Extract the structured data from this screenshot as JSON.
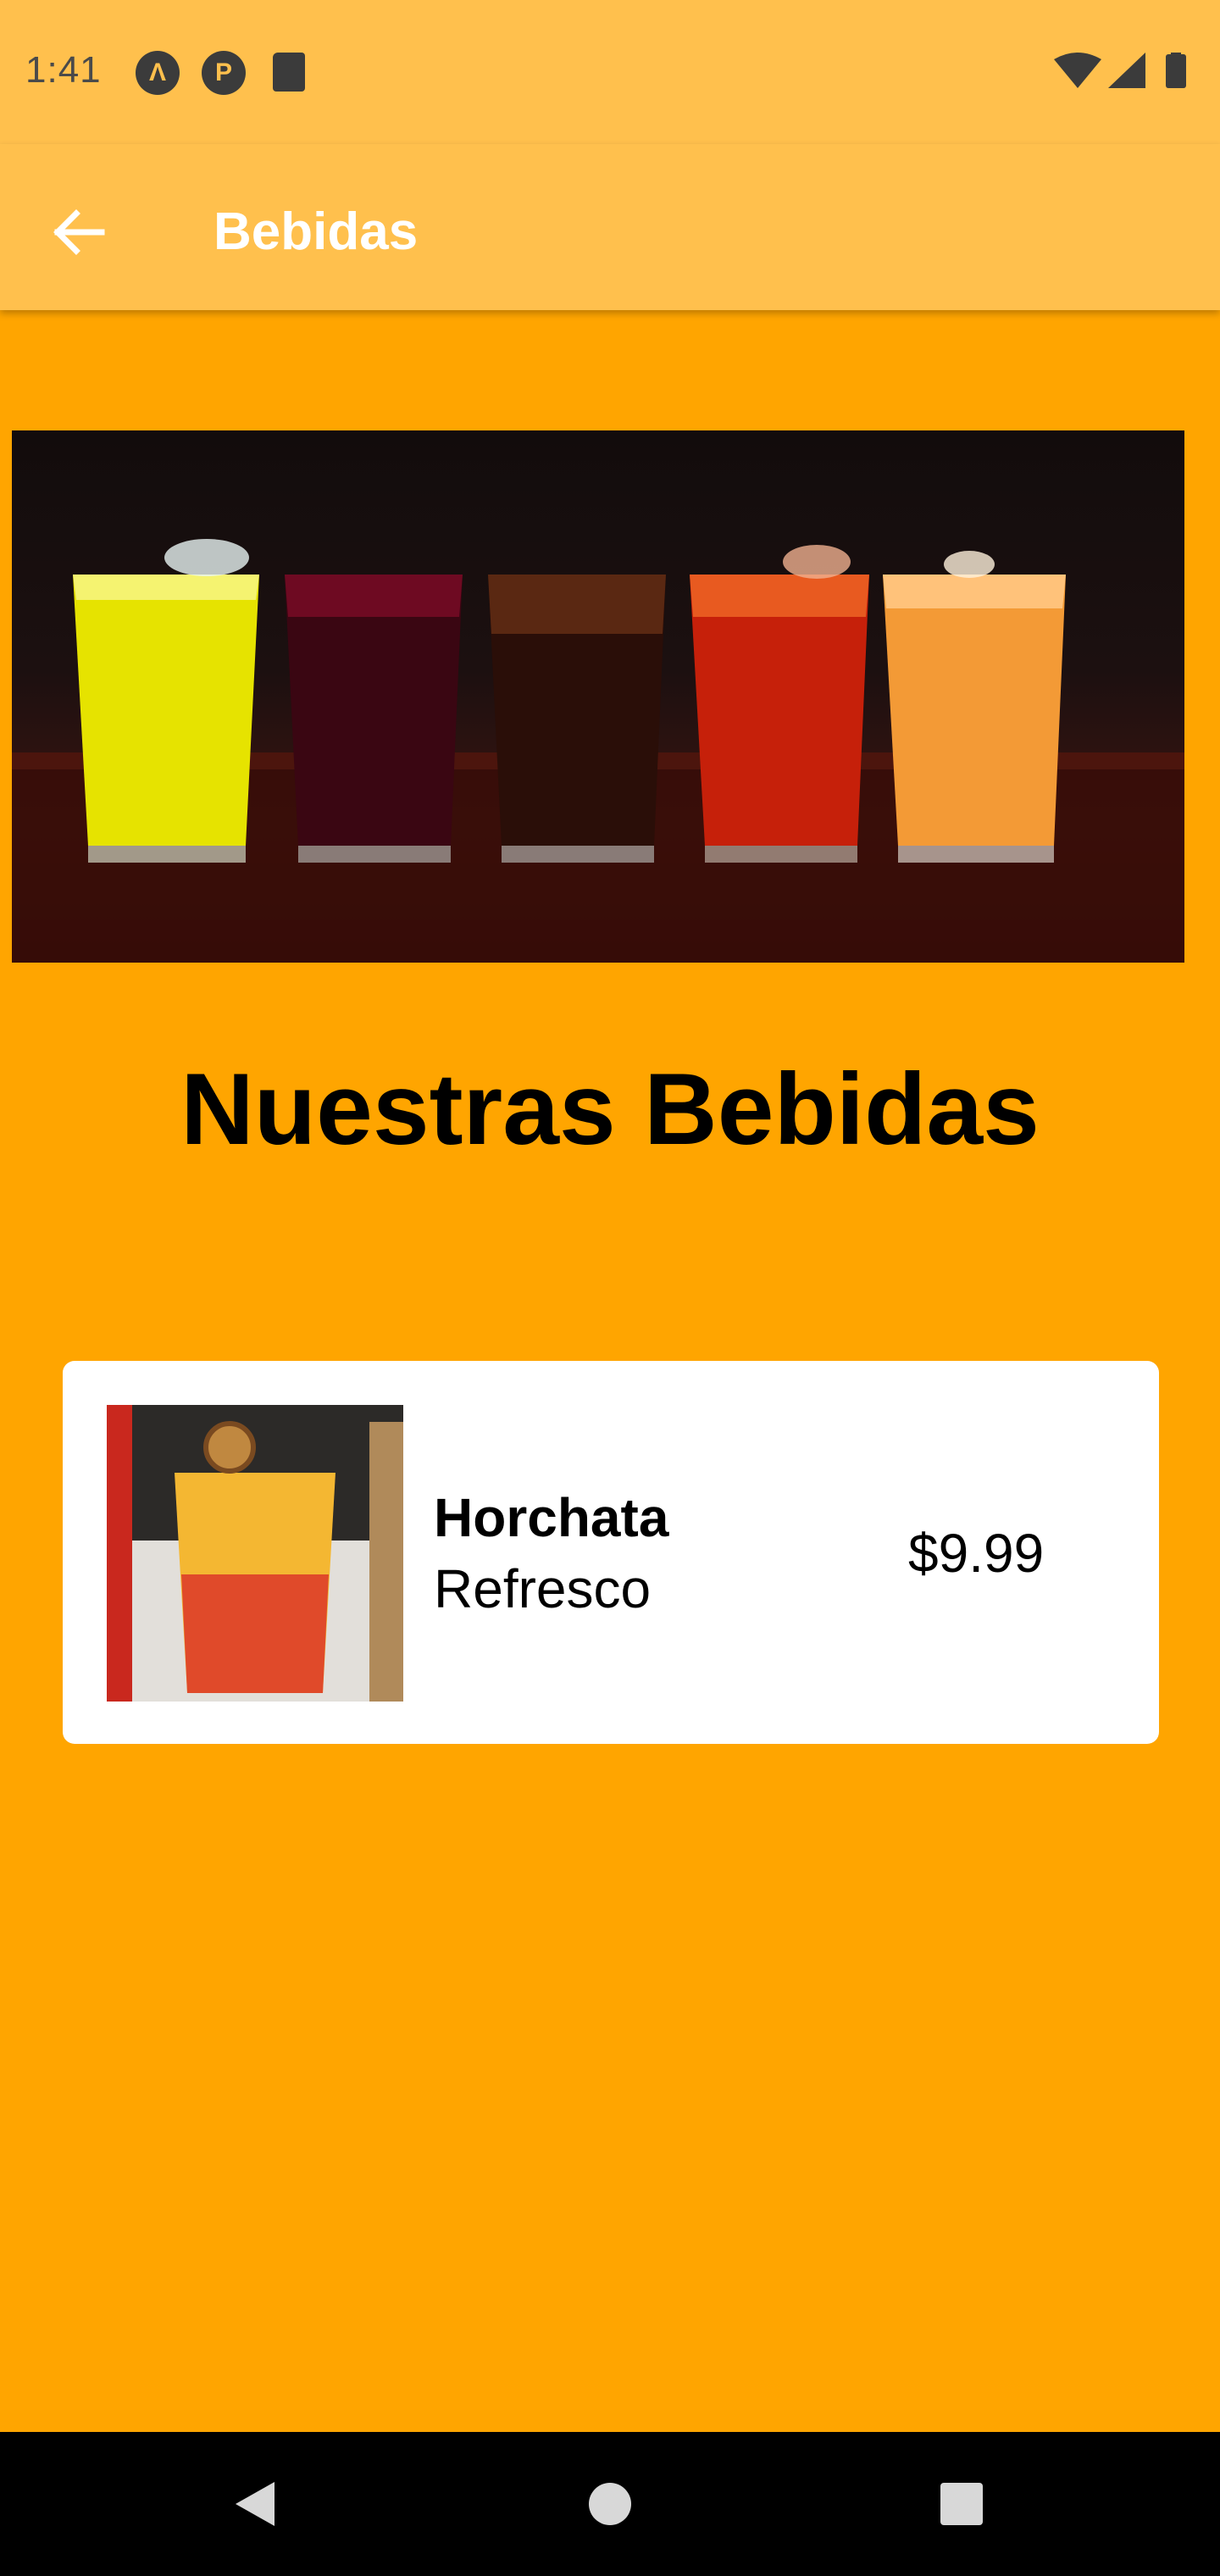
{
  "status_bar": {
    "time": "1:41",
    "icons": [
      "app-a-icon",
      "app-p-icon",
      "sd-card-icon",
      "wifi-icon",
      "signal-icon",
      "battery-icon"
    ]
  },
  "app_bar": {
    "title": "Bebidas",
    "back_icon": "arrow-left-icon"
  },
  "hero": {
    "image": "drinks-banner"
  },
  "section": {
    "title": "Nuestras Bebidas"
  },
  "items": [
    {
      "name": "Horchata",
      "category": "Refresco",
      "price": "$9.99"
    }
  ],
  "nav_bar": {
    "icons": [
      "back-triangle-icon",
      "home-circle-icon",
      "recents-square-icon"
    ]
  },
  "colors": {
    "background": "#FFA500",
    "app_bar": "#FFC04D",
    "card": "#FFFFFF",
    "text": "#000000",
    "title_text": "#FFFFFF"
  }
}
